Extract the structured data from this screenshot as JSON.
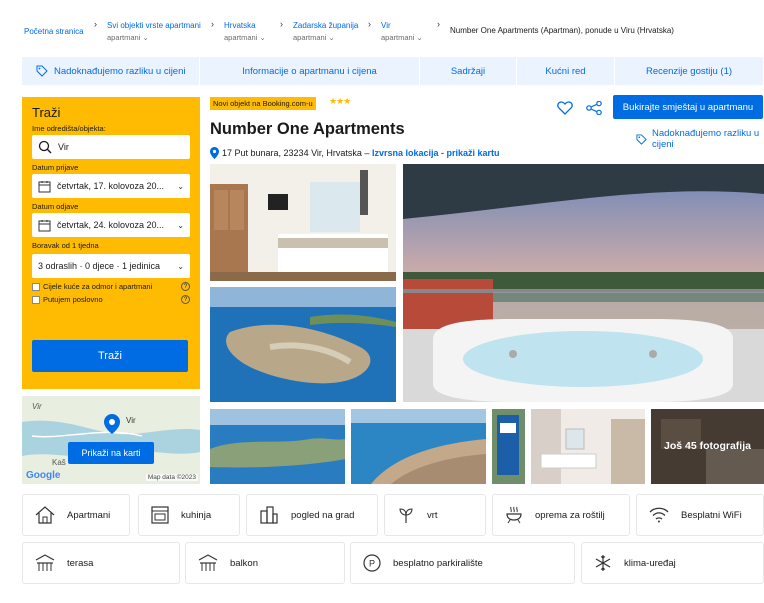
{
  "breadcrumb": {
    "items": [
      {
        "label": "Početna stranica",
        "sub": ""
      },
      {
        "label": "Svi objekti vrste apartmani",
        "sub": "apartmani"
      },
      {
        "label": "Hrvatska",
        "sub": "apartmani"
      },
      {
        "label": "Zadarska županija",
        "sub": "apartmani"
      },
      {
        "label": "Vir",
        "sub": "apartmani"
      }
    ],
    "current": "Number One Apartments (Apartman), ponude u Viru (Hrvatska)"
  },
  "tabs": [
    "Nadoknađujemo razliku u cijeni",
    "Informacije o apartmanu i cijena",
    "Sadržaji",
    "Kućni red",
    "Recenzije gostiju (1)"
  ],
  "search": {
    "title": "Traži",
    "destination_label": "Ime odredišta/objekta:",
    "destination_value": "Vir",
    "checkin_label": "Datum prijave",
    "checkin_value": "četvrtak, 17. kolovoza 20...",
    "checkout_label": "Datum odjave",
    "checkout_value": "četvrtak, 24. kolovoza 20...",
    "stay_label": "Boravak od 1 tjedna",
    "guests_value": "3 odraslih · 0 djece · 1 jedinica",
    "checkbox_homes": "Cijele kuće za odmor i apartmani",
    "checkbox_business": "Putujem poslovno",
    "button": "Traži"
  },
  "map": {
    "button": "Prikaži na karti",
    "place": "Vir",
    "label_2": "Kaš",
    "label_3": "Vir",
    "google": "Google",
    "credit": "Map data ©2023"
  },
  "property": {
    "badge": "Novi objekt na Booking.com-u",
    "stars": "★★★",
    "title": "Number One Apartments",
    "address": "17 Put bunara, 23234 Vir, Hrvatska –",
    "location_link": "Izvrsna lokacija - prikaži kartu",
    "book_button": "Bukirajte smještaj u apartmanu",
    "price_match": "Nadoknađujemo razliku u cijeni"
  },
  "photos": {
    "more_label": "Još 45 fotografija"
  },
  "facilities": [
    {
      "label": "Apartmani",
      "icon": "house-icon"
    },
    {
      "label": "kuhinja",
      "icon": "oven-icon"
    },
    {
      "label": "pogled na grad",
      "icon": "city-icon"
    },
    {
      "label": "vrt",
      "icon": "plant-icon"
    },
    {
      "label": "oprema za roštilj",
      "icon": "grill-icon"
    },
    {
      "label": "Besplatni WiFi",
      "icon": "wifi-icon"
    },
    {
      "label": "terasa",
      "icon": "terrace-icon"
    },
    {
      "label": "balkon",
      "icon": "balcony-icon"
    },
    {
      "label": "besplatno parkiralište",
      "icon": "parking-icon"
    },
    {
      "label": "klima-uređaj",
      "icon": "snowflake-icon"
    }
  ],
  "colors": {
    "brand_blue": "#006ce4",
    "yellow": "#febb02",
    "tab_bg": "#ebf3ff"
  }
}
